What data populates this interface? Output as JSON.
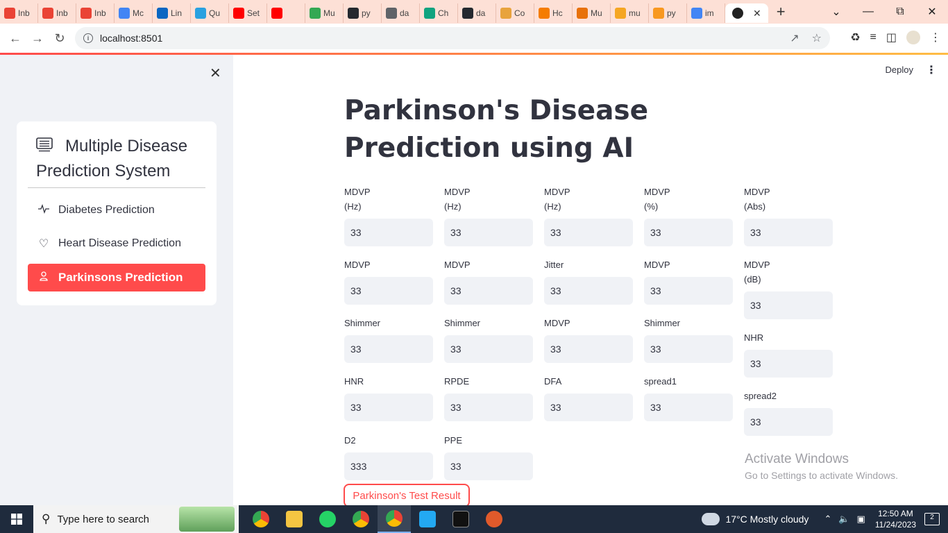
{
  "browser": {
    "tabs": [
      {
        "label": "Inb",
        "color": "#ea4335",
        "icon": "gmail-icon"
      },
      {
        "label": "Inb",
        "color": "#ea4335",
        "icon": "gmail-icon"
      },
      {
        "label": "Inb",
        "color": "#ea4335",
        "icon": "gmail-icon"
      },
      {
        "label": "Mc",
        "color": "#4285f4",
        "icon": "docs-icon"
      },
      {
        "label": "Lin",
        "color": "#0a66c2",
        "icon": "linkedin-icon"
      },
      {
        "label": "Qu",
        "color": "#2aa1e0",
        "icon": "q-icon"
      },
      {
        "label": "Set",
        "color": "#ff0000",
        "icon": "youtube-icon"
      },
      {
        "label": "",
        "color": "#ff0000",
        "icon": "youtube-icon"
      },
      {
        "label": "Mu",
        "color": "#34a853",
        "icon": "drive-icon"
      },
      {
        "label": "py",
        "color": "#24292f",
        "icon": "github-icon"
      },
      {
        "label": "da",
        "color": "#5f6368",
        "icon": "globe-icon"
      },
      {
        "label": "Ch",
        "color": "#10a37f",
        "icon": "chatgpt-icon"
      },
      {
        "label": "da",
        "color": "#24292f",
        "icon": "github-icon"
      },
      {
        "label": "Co",
        "color": "#e8a33d",
        "icon": "colab-icon"
      },
      {
        "label": "Hc",
        "color": "#f57c00",
        "icon": "orange-icon"
      },
      {
        "label": "Mu",
        "color": "#e8710a",
        "icon": "book-icon"
      },
      {
        "label": "mu",
        "color": "#f5a623",
        "icon": "file-icon"
      },
      {
        "label": "py",
        "color": "#f89820",
        "icon": "java-icon"
      },
      {
        "label": "im",
        "color": "#4285f4",
        "icon": "google-icon"
      }
    ],
    "url": "localhost:8501"
  },
  "sidebar": {
    "title": "Multiple Disease Prediction System",
    "items": [
      {
        "label": "Diabetes Prediction",
        "icon": "activity-icon"
      },
      {
        "label": "Heart Disease Prediction",
        "icon": "heart-icon"
      },
      {
        "label": "Parkinsons Prediction",
        "icon": "person-icon"
      }
    ]
  },
  "header": {
    "deploy_label": "Deploy"
  },
  "main": {
    "title": "Parkinson's Disease Prediction using AI",
    "fields": [
      {
        "label": "MDVP\n(Hz)",
        "value": "33"
      },
      {
        "label": "MDVP\n(Hz)",
        "value": "33"
      },
      {
        "label": "MDVP\n(Hz)",
        "value": "33"
      },
      {
        "label": "MDVP\n(%)",
        "value": "33"
      },
      {
        "label": "MDVP\n(Abs)",
        "value": "33"
      },
      {
        "label": "MDVP",
        "value": "33"
      },
      {
        "label": "MDVP",
        "value": "33"
      },
      {
        "label": "Jitter",
        "value": "33"
      },
      {
        "label": "MDVP",
        "value": "33"
      },
      {
        "label": "MDVP\n(dB)",
        "value": "33"
      },
      {
        "label": "Shimmer",
        "value": "33"
      },
      {
        "label": "Shimmer",
        "value": "33"
      },
      {
        "label": "MDVP",
        "value": "33"
      },
      {
        "label": "Shimmer",
        "value": "33"
      },
      {
        "label": "NHR",
        "value": "33"
      },
      {
        "label": "HNR",
        "value": "33"
      },
      {
        "label": "RPDE",
        "value": "33"
      },
      {
        "label": "DFA",
        "value": "33"
      },
      {
        "label": "spread1",
        "value": "33"
      },
      {
        "label": "spread2",
        "value": "33"
      },
      {
        "label": "D2",
        "value": "333"
      },
      {
        "label": "PPE",
        "value": "33"
      }
    ],
    "result_button": "Parkinson's Test Result"
  },
  "watermark": {
    "line1": "Activate Windows",
    "line2": "Go to Settings to activate Windows."
  },
  "taskbar": {
    "search_placeholder": "Type here to search",
    "weather": "17°C  Mostly cloudy",
    "time": "12:50 AM",
    "date": "11/24/2023",
    "notifications": "2"
  }
}
